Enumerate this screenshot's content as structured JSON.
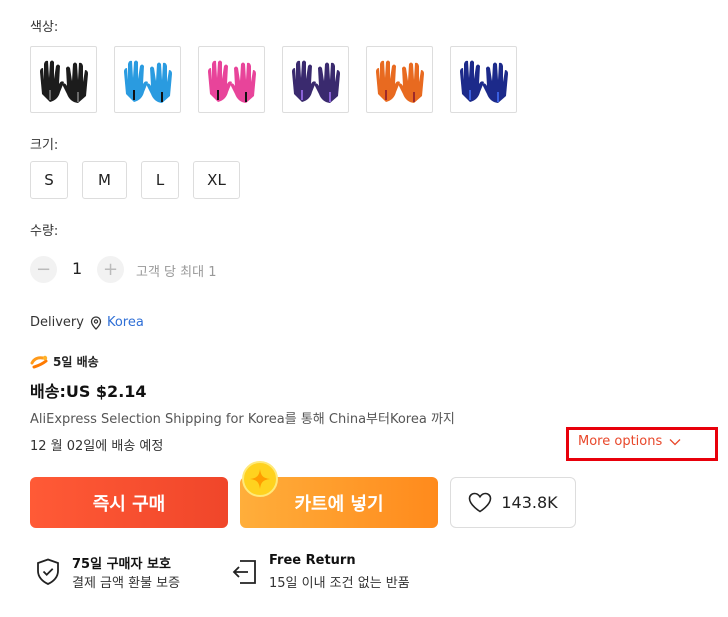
{
  "color_label": "색상:",
  "color_options": [
    {
      "name": "black",
      "hex": "#1c1c1c",
      "accent": "#6a6a6a"
    },
    {
      "name": "sky-blue",
      "hex": "#2a9be0",
      "accent": "#111111"
    },
    {
      "name": "pink",
      "hex": "#e8449a",
      "accent": "#111111"
    },
    {
      "name": "purple",
      "hex": "#3a2a6e",
      "accent": "#8a62d8"
    },
    {
      "name": "orange",
      "hex": "#e86a20",
      "accent": "#9e2a2a"
    },
    {
      "name": "navy",
      "hex": "#1c2a8a",
      "accent": "#3a5fe0"
    }
  ],
  "size_label": "크기:",
  "sizes": [
    "S",
    "M",
    "L",
    "XL"
  ],
  "quantity_label": "수량:",
  "quantity": {
    "minus": "−",
    "value": "1",
    "plus": "+",
    "limit_note": "고객 당 최대 1"
  },
  "delivery": {
    "label": "Delivery",
    "location": "Korea"
  },
  "shipping": {
    "badge_text": "5일 배송",
    "price_text": "배송:US $2.14",
    "description": "AliExpress Selection Shipping for Korea를 통해 China부터Korea 까지",
    "estimate": "12 월 02일에 배송 예정",
    "more_options": "More options"
  },
  "actions": {
    "buy_now": "즉시 구매",
    "add_to_cart": "카트에 넣기",
    "wishlist_count": "143.8K"
  },
  "guarantees": [
    {
      "title": "75일 구매자 보호",
      "subtitle": "결제 금액 환불 보증"
    },
    {
      "title": "Free Return",
      "subtitle": "15일 이내 조건 없는 반품"
    }
  ],
  "colors": {
    "link": "#2f6fd6",
    "highlight_box": "#e8000b",
    "buy_now_gradient": [
      "#ff5a36",
      "#f0462a"
    ],
    "cart_gradient": [
      "#ffae3b",
      "#ff8a1c"
    ],
    "more_options_text": "#e8472a"
  }
}
